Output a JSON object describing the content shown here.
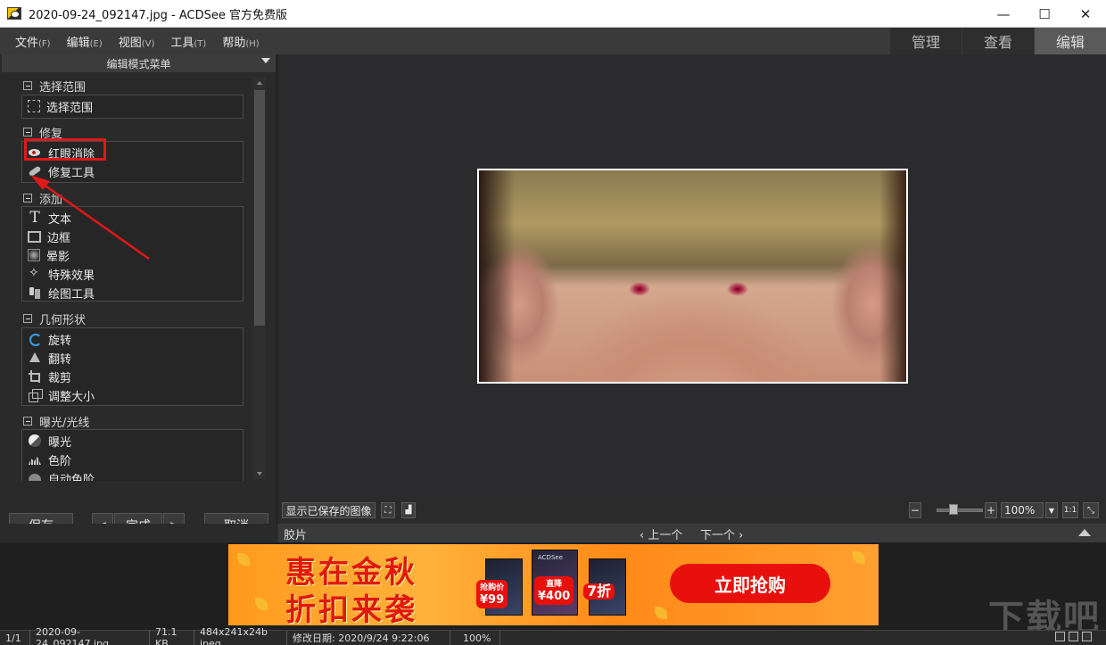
{
  "window": {
    "title": "2020-09-24_092147.jpg - ACDSee 官方免费版",
    "minimize": "—",
    "maximize": "☐",
    "close": "✕"
  },
  "menu": {
    "items": [
      {
        "label": "文件",
        "key": "(F)"
      },
      {
        "label": "编辑",
        "key": "(E)"
      },
      {
        "label": "视图",
        "key": "(V)"
      },
      {
        "label": "工具",
        "key": "(T)"
      },
      {
        "label": "帮助",
        "key": "(H)"
      }
    ],
    "modes": [
      "管理",
      "查看",
      "编辑"
    ],
    "active_mode": "编辑"
  },
  "edit_panel": {
    "header": "编辑模式菜单",
    "sections": [
      {
        "title": "选择范围",
        "items": [
          "选择范围"
        ]
      },
      {
        "title": "修复",
        "items": [
          "红眼消除",
          "修复工具"
        ]
      },
      {
        "title": "添加",
        "items": [
          "文本",
          "边框",
          "晕影",
          "特殊效果",
          "绘图工具"
        ]
      },
      {
        "title": "几何形状",
        "items": [
          "旋转",
          "翻转",
          "裁剪",
          "调整大小"
        ]
      },
      {
        "title": "曝光/光线",
        "items": [
          "曝光",
          "色阶",
          "自动色阶"
        ]
      }
    ],
    "buttons": {
      "save": "保存",
      "prev": "<",
      "done": "完成",
      "next": ">",
      "cancel": "取消"
    }
  },
  "toolbar": {
    "show_saved": "显示已保存的图像",
    "zoom_minus": "−",
    "zoom_plus": "+",
    "zoom_value": "100%",
    "actual_size": "1:1"
  },
  "filmstrip": {
    "label": "胶片",
    "prev": "上一个",
    "next": "下一个"
  },
  "banner": {
    "line1": "惠在金秋",
    "line2": "折扣来袭",
    "price1_label": "抢购价",
    "price1": "¥99",
    "price2_label": "直降",
    "price2": "¥400",
    "discount": "7折",
    "cta": "立即抢购",
    "brand": "ACDSee"
  },
  "watermark": "下载吧",
  "status": {
    "index": "1/1",
    "filename": "2020-09-24_092147.jpg",
    "size": "71.1 KB",
    "dimensions": "484x241x24b jpeg",
    "modified": "修改日期: 2020/9/24 9:22:06",
    "zoom": "100%"
  },
  "colors": {
    "highlight": "#e01818",
    "cta": "#e8100c",
    "accent_rotate": "#35a0e8"
  }
}
